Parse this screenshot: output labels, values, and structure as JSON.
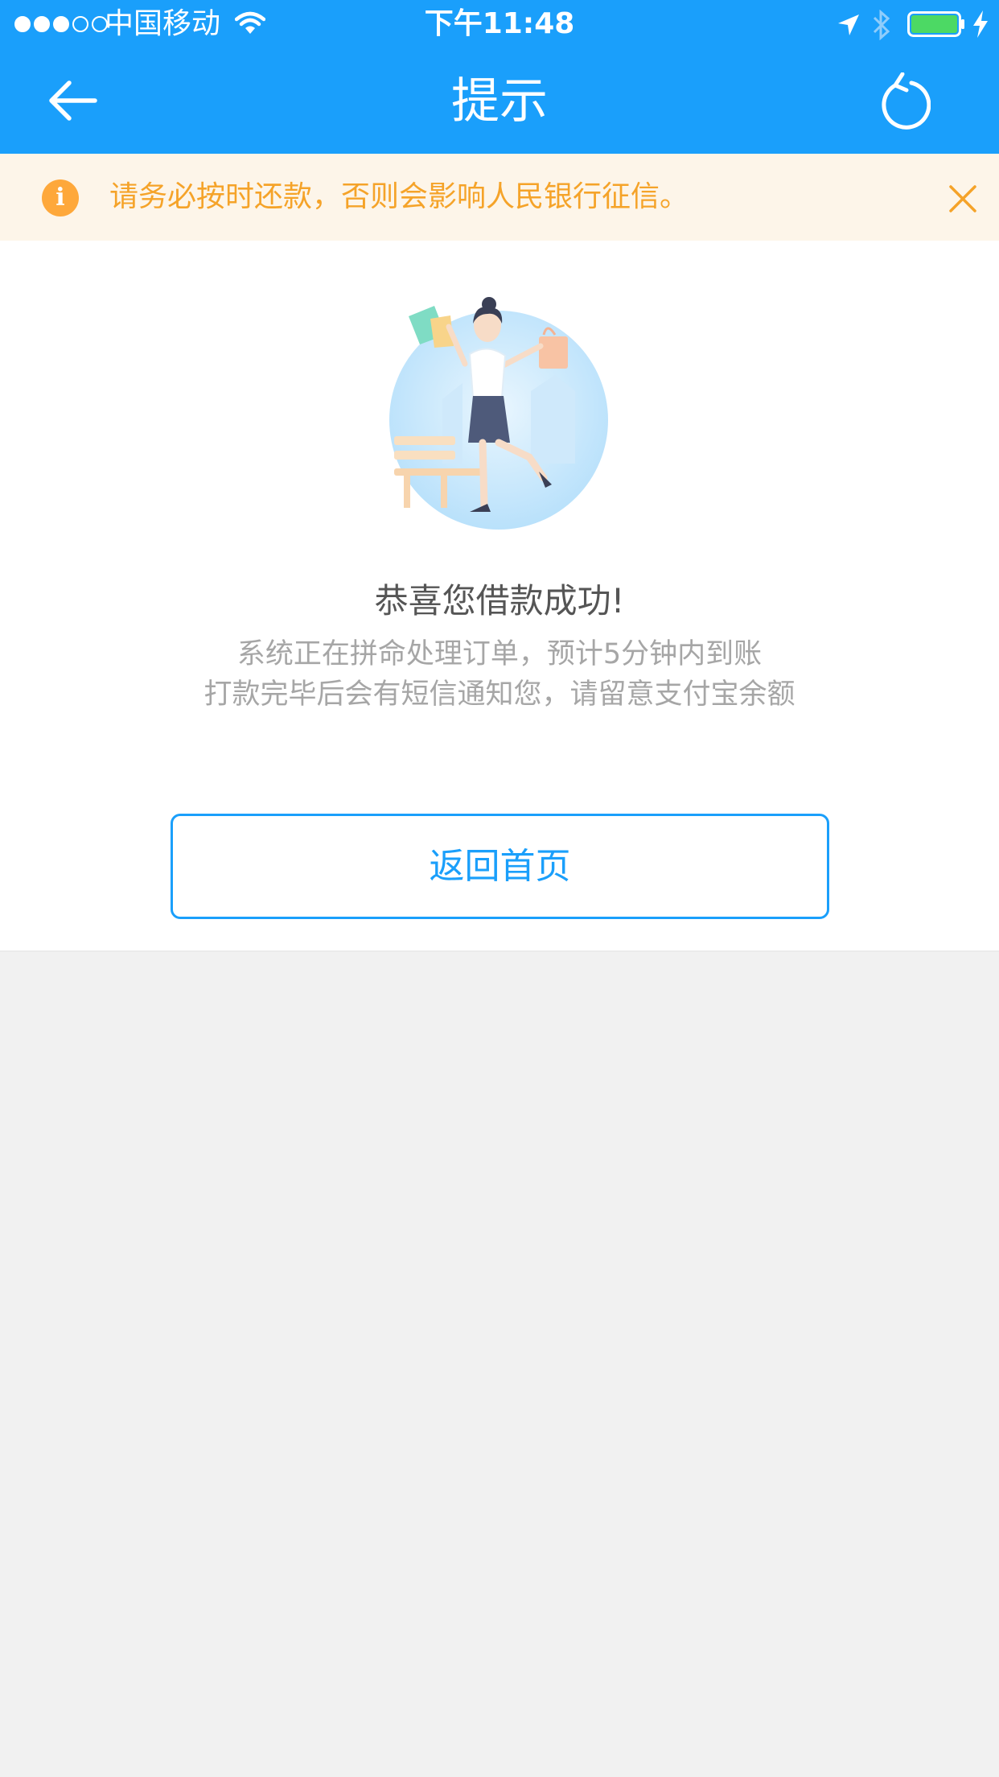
{
  "status_bar": {
    "carrier": "中国移动",
    "time": "下午11:48",
    "signal_bars_filled": 3,
    "signal_bars_total": 5,
    "battery_color": "#4cd964"
  },
  "nav": {
    "title": "提示",
    "back_icon": "arrow-left-icon",
    "refresh_icon": "refresh-icon",
    "background_color": "#1a9ffb"
  },
  "notice": {
    "text": "请务必按时还款，否则会影响人民银行征信。",
    "info_glyph": "i",
    "text_color": "#f5a329",
    "background_color": "#fdf5e9"
  },
  "result": {
    "title": "恭喜您借款成功!",
    "description_line_1": "系统正在拼命处理订单，预计5分钟内到账",
    "description_line_2": "打款完毕后会有短信通知您，请留意支付宝余额"
  },
  "actions": {
    "home_label": "返回首页",
    "accent_color": "#1a9ffb"
  }
}
